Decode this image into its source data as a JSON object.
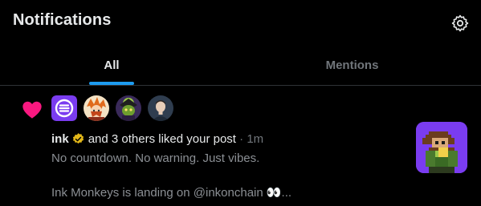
{
  "header": {
    "title": "Notifications",
    "settings_icon": "gear-icon"
  },
  "tabs": [
    {
      "label": "All",
      "selected": true
    },
    {
      "label": "Mentions",
      "selected": false
    }
  ],
  "colors": {
    "accent": "#1d9bf0",
    "like": "#f91880",
    "background": "#000000",
    "muted": "#71767b",
    "verified": "#e2b719"
  },
  "notification": {
    "type_icon": "heart-icon",
    "avatars": [
      "ink-logo-avatar",
      "anime-character-avatar",
      "green-mask-avatar",
      "portrait-avatar"
    ],
    "actor": "ink",
    "verified_icon": "verified-badge-icon",
    "action": "and 3 others liked your post",
    "separator": "·",
    "time": "1m",
    "post_line1": "No countdown. No warning. Just vibes.",
    "post_line2": "Ink Monkeys is landing on @inkonchain 👀...",
    "thumbnail": "pixel-monkey-image"
  }
}
